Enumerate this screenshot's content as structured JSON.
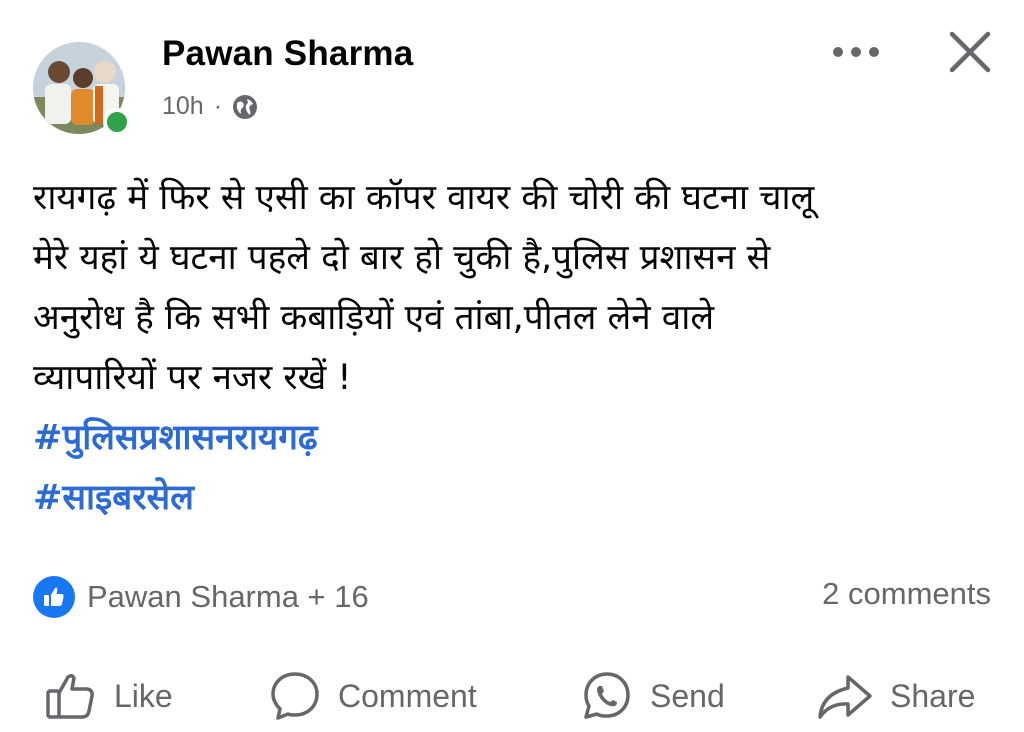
{
  "post": {
    "author": "Pawan Sharma",
    "time": "10h",
    "separator": "·",
    "audience_icon": "globe-icon",
    "lines": [
      "रायगढ़ में फिर से एसी का कॉपर वायर की चोरी की घटना चालू",
      "मेरे यहां ये घटना पहले दो बार हो चुकी है,पुलिस प्रशासन से",
      "अनुरोध है कि सभी कबाड़ियों एवं तांबा,पीतल लेने वाले",
      "व्यापारियों पर नजर रखें !"
    ],
    "hashtags": [
      "#पुलिसप्रशासनरायगढ़",
      "#साइबरसेल"
    ]
  },
  "reactions": {
    "text": "Pawan Sharma + 16",
    "icon": "like-reaction-icon"
  },
  "comments_count": "2 comments",
  "actions": {
    "like": "Like",
    "comment": "Comment",
    "send": "Send",
    "share": "Share"
  },
  "colors": {
    "accent": "#1877f2",
    "hashtag": "#2d6bd4",
    "online": "#31a24c",
    "secondary_text": "#65676b"
  }
}
